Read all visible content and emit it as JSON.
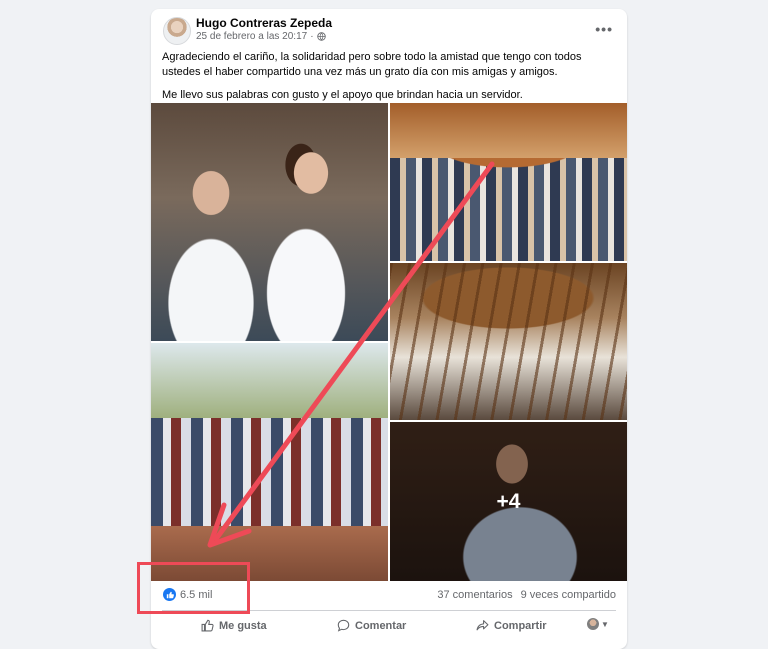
{
  "post": {
    "author": "Hugo Contreras Zepeda",
    "date": "25 de febrero a las 20:17",
    "separator": "·",
    "paragraphs": [
      "Agradeciendo el cariño, la solidaridad pero sobre todo la amistad que tengo con todos ustedes el haber compartido una vez más un grato día con mis amigas y amigos.",
      "Me llevo sus palabras con gusto y el apoyo que brindan hacia un servidor."
    ],
    "more_photos_label": "+4"
  },
  "stats": {
    "reactions": "6.5 mil",
    "comments": "37 comentarios",
    "shares": "9 veces compartido"
  },
  "actions": {
    "like": "Me gusta",
    "comment": "Comentar",
    "share": "Compartir"
  },
  "icons": {
    "options": "more-options-icon",
    "privacy": "globe-icon",
    "like": "thumbs-up-icon",
    "comment": "speech-bubble-icon",
    "share": "share-arrow-icon"
  },
  "colors": {
    "accent": "#1877f2",
    "annotation": "#ee4a57"
  }
}
